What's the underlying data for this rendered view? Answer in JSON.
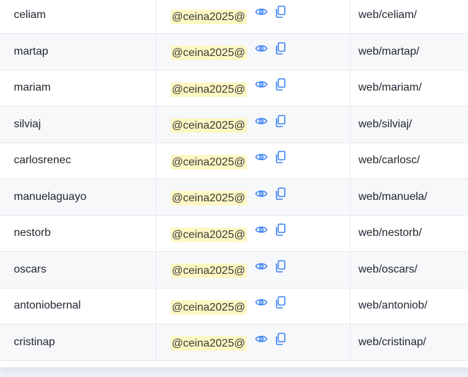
{
  "colors": {
    "icon": "#3b82f6",
    "password_highlight": "#fdf7c3",
    "row_alt": "#f7f8fa",
    "border": "#e5e8ee"
  },
  "icons": {
    "show_password": "eye-icon",
    "copy_password": "copy-icon"
  },
  "rows": [
    {
      "user": "celiam",
      "password": "@ceina2025@",
      "path": "web/celiam/"
    },
    {
      "user": "martap",
      "password": "@ceina2025@",
      "path": "web/martap/"
    },
    {
      "user": "mariam",
      "password": "@ceina2025@",
      "path": "web/mariam/"
    },
    {
      "user": "silviaj",
      "password": "@ceina2025@",
      "path": "web/silviaj/"
    },
    {
      "user": "carlosrenec",
      "password": "@ceina2025@",
      "path": "web/carlosc/"
    },
    {
      "user": "manuelaguayo",
      "password": "@ceina2025@",
      "path": "web/manuela/"
    },
    {
      "user": "nestorb",
      "password": "@ceina2025@",
      "path": "web/nestorb/"
    },
    {
      "user": "oscars",
      "password": "@ceina2025@",
      "path": "web/oscars/"
    },
    {
      "user": "antoniobernal",
      "password": "@ceina2025@",
      "path": "web/antoniob/"
    },
    {
      "user": "cristinap",
      "password": "@ceina2025@",
      "path": "web/cristinap/"
    }
  ]
}
